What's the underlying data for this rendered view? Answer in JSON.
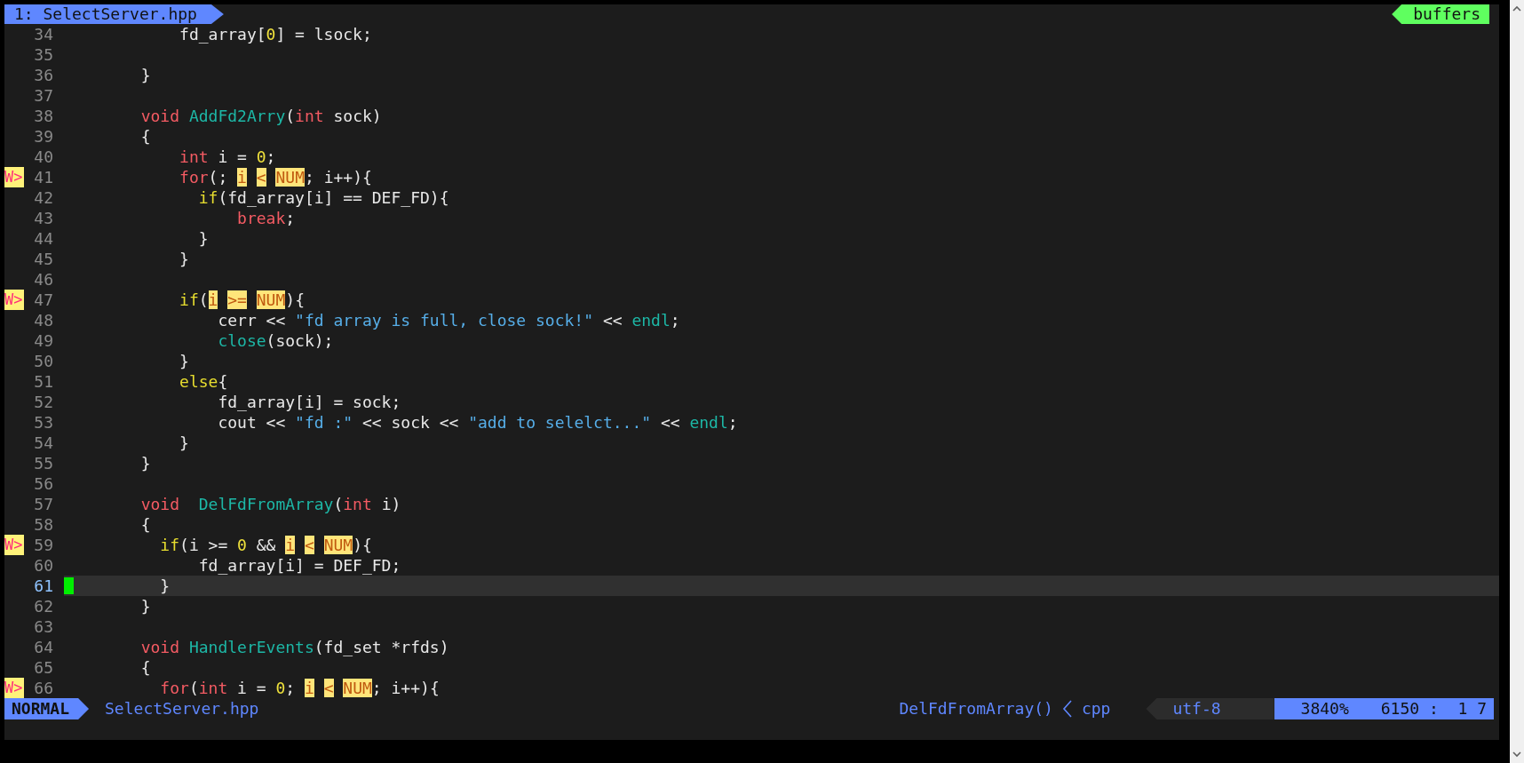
{
  "tabline": {
    "tab": "1: SelectServer.hpp",
    "buffers": "buffers"
  },
  "lines": [
    {
      "number": "34",
      "current": false,
      "segments": [
        {
          "text": "            fd_array[",
          "kind": "plain"
        },
        {
          "text": "0",
          "kind": "number"
        },
        {
          "text": "] = lsock;",
          "kind": "plain"
        }
      ]
    },
    {
      "number": "35",
      "current": false
    },
    {
      "number": "36",
      "current": false,
      "segments": [
        {
          "text": "        }",
          "kind": "plain"
        }
      ]
    },
    {
      "number": "37",
      "current": false
    },
    {
      "number": "38",
      "current": false,
      "segments": [
        {
          "text": "        void ",
          "kind": "keyword"
        },
        {
          "text": "AddFd2Arry",
          "kind": "function"
        },
        {
          "text": "(",
          "kind": "plain"
        },
        {
          "text": "int",
          "kind": "keyword"
        },
        {
          "text": " sock)",
          "kind": "plain"
        }
      ]
    },
    {
      "number": "39",
      "current": false,
      "segments": [
        {
          "text": "        {",
          "kind": "plain"
        }
      ]
    },
    {
      "number": "40",
      "current": false,
      "segments": [
        {
          "text": "            int",
          "kind": "keyword"
        },
        {
          "text": " i = ",
          "kind": "plain"
        },
        {
          "text": "0",
          "kind": "number"
        },
        {
          "text": ";",
          "kind": "plain"
        }
      ]
    },
    {
      "number": "41",
      "sign": "W>",
      "current": false,
      "segments": [
        {
          "text": "            for",
          "kind": "keyword"
        },
        {
          "text": "(; ",
          "kind": "plain"
        },
        {
          "text": "i < NUM",
          "kind": "match"
        },
        {
          "text": "; i++){",
          "kind": "plain"
        }
      ]
    },
    {
      "number": "42",
      "current": false,
      "segments": [
        {
          "text": "              if",
          "kind": "conditional"
        },
        {
          "text": "(fd_array[i] == DEF_FD){",
          "kind": "plain"
        }
      ]
    },
    {
      "number": "43",
      "current": false,
      "segments": [
        {
          "text": "                  break",
          "kind": "keyword"
        },
        {
          "text": ";",
          "kind": "plain"
        }
      ]
    },
    {
      "number": "44",
      "current": false,
      "segments": [
        {
          "text": "              }",
          "kind": "plain"
        }
      ]
    },
    {
      "number": "45",
      "current": false,
      "segments": [
        {
          "text": "            }",
          "kind": "plain"
        }
      ]
    },
    {
      "number": "46",
      "current": false
    },
    {
      "number": "47",
      "sign": "W>",
      "current": false,
      "segments": [
        {
          "text": "            if",
          "kind": "conditional"
        },
        {
          "text": "(",
          "kind": "plain"
        },
        {
          "text": "i >= NUM",
          "kind": "match"
        },
        {
          "text": "){",
          "kind": "plain"
        }
      ]
    },
    {
      "number": "48",
      "current": false,
      "segments": [
        {
          "text": "                cerr << ",
          "kind": "plain"
        },
        {
          "text": "\"fd array is full, close sock!\"",
          "kind": "string"
        },
        {
          "text": " << ",
          "kind": "plain"
        },
        {
          "text": "endl",
          "kind": "function"
        },
        {
          "text": ";",
          "kind": "plain"
        }
      ]
    },
    {
      "number": "49",
      "current": false,
      "segments": [
        {
          "text": "                close",
          "kind": "function"
        },
        {
          "text": "(sock);",
          "kind": "plain"
        }
      ]
    },
    {
      "number": "50",
      "current": false,
      "segments": [
        {
          "text": "            }",
          "kind": "plain"
        }
      ]
    },
    {
      "number": "51",
      "current": false,
      "segments": [
        {
          "text": "            else",
          "kind": "conditional"
        },
        {
          "text": "{",
          "kind": "plain"
        }
      ]
    },
    {
      "number": "52",
      "current": false,
      "segments": [
        {
          "text": "                fd_array[i] = sock;",
          "kind": "plain"
        }
      ]
    },
    {
      "number": "53",
      "current": false,
      "segments": [
        {
          "text": "                cout << ",
          "kind": "plain"
        },
        {
          "text": "\"fd :\"",
          "kind": "string"
        },
        {
          "text": " << sock << ",
          "kind": "plain"
        },
        {
          "text": "\"add to selelct...\"",
          "kind": "string"
        },
        {
          "text": " << ",
          "kind": "plain"
        },
        {
          "text": "endl",
          "kind": "function"
        },
        {
          "text": ";",
          "kind": "plain"
        }
      ]
    },
    {
      "number": "54",
      "current": false,
      "segments": [
        {
          "text": "            }",
          "kind": "plain"
        }
      ]
    },
    {
      "number": "55",
      "current": false,
      "segments": [
        {
          "text": "        }",
          "kind": "plain"
        }
      ]
    },
    {
      "number": "56",
      "current": false
    },
    {
      "number": "57",
      "current": false,
      "segments": [
        {
          "text": "        void  ",
          "kind": "keyword"
        },
        {
          "text": "DelFdFromArray",
          "kind": "function"
        },
        {
          "text": "(",
          "kind": "plain"
        },
        {
          "text": "int",
          "kind": "keyword"
        },
        {
          "text": " i)",
          "kind": "plain"
        }
      ]
    },
    {
      "number": "58",
      "current": false,
      "segments": [
        {
          "text": "        {",
          "kind": "plain"
        }
      ]
    },
    {
      "number": "59",
      "sign": "W>",
      "current": false,
      "segments": [
        {
          "text": "          if",
          "kind": "conditional"
        },
        {
          "text": "(i >= ",
          "kind": "plain"
        },
        {
          "text": "0",
          "kind": "number"
        },
        {
          "text": " && ",
          "kind": "plain"
        },
        {
          "text": "i < NUM",
          "kind": "match"
        },
        {
          "text": "){",
          "kind": "plain"
        }
      ]
    },
    {
      "number": "60",
      "current": false,
      "segments": [
        {
          "text": "              fd_array[i] = DEF_FD;",
          "kind": "plain"
        }
      ]
    },
    {
      "number": "61",
      "current": true,
      "segments": [
        {
          "text": "          }",
          "kind": "plain"
        }
      ]
    },
    {
      "number": "62",
      "current": false,
      "segments": [
        {
          "text": "        }",
          "kind": "plain"
        }
      ]
    },
    {
      "number": "63",
      "current": false
    },
    {
      "number": "64",
      "current": false,
      "segments": [
        {
          "text": "        void ",
          "kind": "keyword"
        },
        {
          "text": "HandlerEvents",
          "kind": "function"
        },
        {
          "text": "(fd_set *rfds)",
          "kind": "plain"
        }
      ]
    },
    {
      "number": "65",
      "current": false,
      "segments": [
        {
          "text": "        {",
          "kind": "plain"
        }
      ]
    },
    {
      "number": "66",
      "sign": "W>",
      "current": false,
      "segments": [
        {
          "text": "          for",
          "kind": "keyword"
        },
        {
          "text": "(",
          "kind": "plain"
        },
        {
          "text": "int",
          "kind": "keyword"
        },
        {
          "text": " i = ",
          "kind": "plain"
        },
        {
          "text": "0",
          "kind": "number"
        },
        {
          "text": "; ",
          "kind": "plain"
        },
        {
          "text": "i < NUM",
          "kind": "match"
        },
        {
          "text": "; i++){",
          "kind": "plain"
        }
      ]
    }
  ],
  "status_bar": {
    "mode": "NORMAL",
    "file": "SelectServer.hpp",
    "function": "DelFdFromArray()",
    "filetype": "cpp",
    "encoding": "utf-8",
    "percent": "3840%",
    "position": "6150 :  1 7"
  }
}
